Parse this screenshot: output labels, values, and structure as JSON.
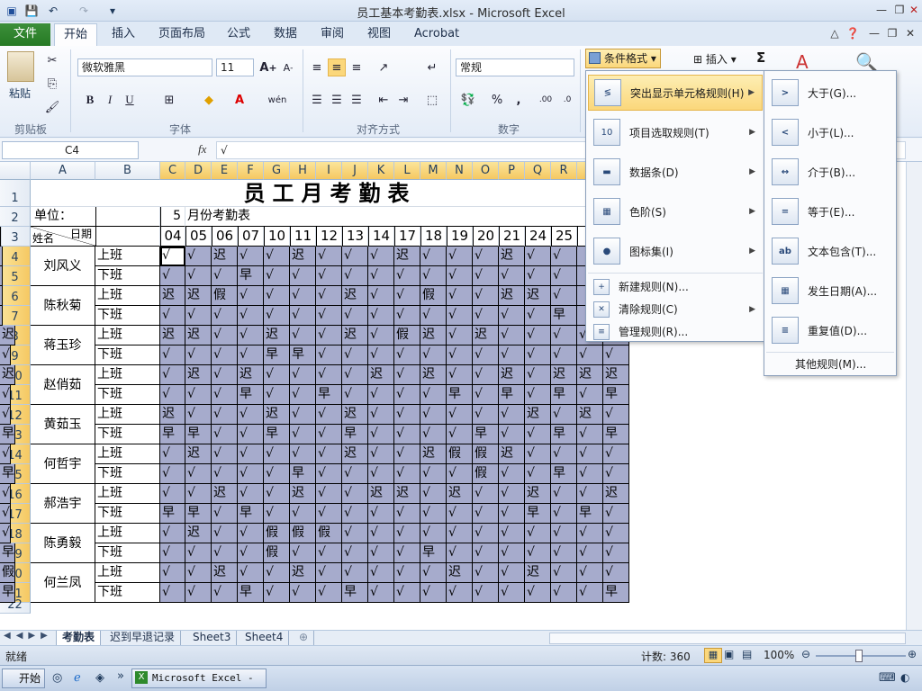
{
  "window": {
    "title": "员工基本考勤表.xlsx - Microsoft Excel"
  },
  "qat": {
    "save": "💾",
    "undo": "↶",
    "redo": "↷",
    "customize": "▾"
  },
  "tabs": [
    {
      "label": "文件"
    },
    {
      "label": "开始"
    },
    {
      "label": "插入"
    },
    {
      "label": "页面布局"
    },
    {
      "label": "公式"
    },
    {
      "label": "数据"
    },
    {
      "label": "审阅"
    },
    {
      "label": "视图"
    },
    {
      "label": "Acrobat"
    }
  ],
  "ribbon": {
    "clipboard": {
      "paste": "粘贴",
      "label": "剪贴板"
    },
    "font": {
      "name": "微软雅黑",
      "size": "11",
      "label": "字体",
      "bold": "B",
      "italic": "I",
      "underline": "U"
    },
    "alignment": {
      "label": "对齐方式"
    },
    "number": {
      "format": "常规",
      "label": "数字",
      "percent": "%",
      "comma": ","
    },
    "styles": {
      "cond_format": "条件格式"
    },
    "cells": {
      "insert": "插入"
    },
    "editing": {
      "sum": "Σ"
    }
  },
  "formula_bar": {
    "name_box": "C4",
    "fx": "fx",
    "value": "√"
  },
  "columns": [
    "A",
    "B",
    "C",
    "D",
    "E",
    "F",
    "G",
    "H",
    "I",
    "J",
    "K",
    "L",
    "M",
    "N",
    "O",
    "P",
    "Q",
    "R",
    "S",
    "T"
  ],
  "sheet": {
    "title": "员工月考勤表",
    "unit_label": "单位：",
    "month": "5",
    "month_label": "月份考勤表",
    "corner_top": "日期",
    "corner_bottom": "姓名",
    "dates": [
      "04",
      "05",
      "06",
      "07",
      "10",
      "11",
      "12",
      "13",
      "14",
      "17",
      "18",
      "19",
      "20",
      "21",
      "24",
      "25",
      "",
      "",
      ""
    ],
    "shift_on": "上班",
    "shift_off": "下班",
    "employees": [
      {
        "name": "刘风义",
        "on": [
          "√",
          "√",
          "迟",
          "√",
          "√",
          "迟",
          "√",
          "√",
          "√",
          "迟",
          "√",
          "√",
          "√",
          "迟",
          "√",
          "√",
          "",
          "",
          ""
        ],
        "off": [
          "√",
          "√",
          "√",
          "早",
          "√",
          "√",
          "√",
          "√",
          "√",
          "√",
          "√",
          "√",
          "√",
          "√",
          "√",
          "√",
          "",
          "",
          ""
        ]
      },
      {
        "name": "陈秋菊",
        "on": [
          "迟",
          "迟",
          "假",
          "√",
          "√",
          "√",
          "√",
          "迟",
          "√",
          "√",
          "假",
          "√",
          "√",
          "迟",
          "迟",
          "√",
          "",
          "",
          ""
        ],
        "off": [
          "√",
          "√",
          "√",
          "√",
          "√",
          "√",
          "√",
          "√",
          "√",
          "√",
          "√",
          "√",
          "√",
          "√",
          "√",
          "早",
          "",
          "",
          ""
        ]
      },
      {
        "name": "蒋玉珍",
        "on": [
          "迟",
          "迟",
          "√",
          "√",
          "迟",
          "√",
          "√",
          "迟",
          "√",
          "假",
          "迟",
          "√",
          "迟",
          "√",
          "√",
          "√",
          "√",
          "迟",
          "迟"
        ],
        "off": [
          "√",
          "√",
          "√",
          "√",
          "早",
          "早",
          "√",
          "√",
          "√",
          "√",
          "√",
          "√",
          "√",
          "√",
          "√",
          "√",
          "√",
          "√",
          "√"
        ]
      },
      {
        "name": "赵俏茹",
        "on": [
          "√",
          "迟",
          "√",
          "迟",
          "√",
          "√",
          "√",
          "√",
          "迟",
          "√",
          "迟",
          "√",
          "√",
          "迟",
          "√",
          "迟",
          "迟",
          "迟",
          "迟"
        ],
        "off": [
          "√",
          "√",
          "√",
          "早",
          "√",
          "√",
          "早",
          "√",
          "√",
          "√",
          "√",
          "早",
          "√",
          "早",
          "√",
          "早",
          "√",
          "早",
          "√"
        ]
      },
      {
        "name": "黄茹玉",
        "on": [
          "迟",
          "√",
          "√",
          "√",
          "迟",
          "√",
          "√",
          "迟",
          "√",
          "√",
          "√",
          "√",
          "√",
          "√",
          "迟",
          "√",
          "迟",
          "√",
          "√"
        ],
        "off": [
          "早",
          "早",
          "√",
          "√",
          "早",
          "√",
          "√",
          "早",
          "√",
          "√",
          "√",
          "√",
          "早",
          "√",
          "√",
          "早",
          "√",
          "早",
          "早"
        ]
      },
      {
        "name": "何哲宇",
        "on": [
          "√",
          "迟",
          "√",
          "√",
          "√",
          "√",
          "√",
          "迟",
          "√",
          "√",
          "迟",
          "假",
          "假",
          "迟",
          "√",
          "√",
          "√",
          "√",
          "√"
        ],
        "off": [
          "√",
          "√",
          "√",
          "√",
          "√",
          "早",
          "√",
          "√",
          "√",
          "√",
          "√",
          "√",
          "假",
          "√",
          "√",
          "早",
          "√",
          "√",
          "早"
        ]
      },
      {
        "name": "郝浩宇",
        "on": [
          "√",
          "√",
          "迟",
          "√",
          "√",
          "迟",
          "√",
          "√",
          "迟",
          "迟",
          "√",
          "迟",
          "√",
          "√",
          "迟",
          "√",
          "√",
          "迟",
          "√"
        ],
        "off": [
          "早",
          "早",
          "√",
          "早",
          "√",
          "√",
          "√",
          "√",
          "√",
          "√",
          "√",
          "√",
          "√",
          "√",
          "早",
          "√",
          "早",
          "√",
          "√"
        ]
      },
      {
        "name": "陈勇毅",
        "on": [
          "√",
          "迟",
          "√",
          "√",
          "假",
          "假",
          "假",
          "√",
          "√",
          "√",
          "√",
          "√",
          "√",
          "√",
          "√",
          "√",
          "√",
          "√",
          "√"
        ],
        "off": [
          "√",
          "√",
          "√",
          "√",
          "假",
          "√",
          "√",
          "√",
          "√",
          "√",
          "早",
          "√",
          "√",
          "√",
          "√",
          "√",
          "√",
          "√",
          "早"
        ]
      },
      {
        "name": "何兰凤",
        "on": [
          "√",
          "√",
          "迟",
          "√",
          "√",
          "迟",
          "√",
          "√",
          "√",
          "√",
          "√",
          "迟",
          "√",
          "√",
          "迟",
          "√",
          "√",
          "√",
          "假"
        ],
        "off": [
          "√",
          "√",
          "√",
          "早",
          "√",
          "√",
          "√",
          "早",
          "√",
          "√",
          "√",
          "√",
          "√",
          "√",
          "√",
          "√",
          "√",
          "早",
          "早"
        ]
      }
    ]
  },
  "cf_menu": {
    "items": [
      {
        "label": "突出显示单元格规则(H)",
        "icon": "highlight-cells-icon",
        "glyph": "≶"
      },
      {
        "label": "项目选取规则(T)",
        "icon": "top-bottom-icon",
        "glyph": "10"
      },
      {
        "label": "数据条(D)",
        "icon": "data-bars-icon",
        "glyph": "▬"
      },
      {
        "label": "色阶(S)",
        "icon": "color-scale-icon",
        "glyph": "▦"
      },
      {
        "label": "图标集(I)",
        "icon": "icon-sets-icon",
        "glyph": "●"
      }
    ],
    "small_items": [
      {
        "label": "新建规则(N)...",
        "icon": "new-rule-icon",
        "glyph": "+"
      },
      {
        "label": "清除规则(C)",
        "icon": "clear-rules-icon",
        "glyph": "✕"
      },
      {
        "label": "管理规则(R)...",
        "icon": "manage-rules-icon",
        "glyph": "≡"
      }
    ]
  },
  "sub_menu": {
    "items": [
      {
        "label": "大于(G)...",
        "glyph": ">"
      },
      {
        "label": "小于(L)...",
        "glyph": "<"
      },
      {
        "label": "介于(B)...",
        "glyph": "↔"
      },
      {
        "label": "等于(E)...",
        "glyph": "="
      },
      {
        "label": "文本包含(T)...",
        "glyph": "ab"
      },
      {
        "label": "发生日期(A)...",
        "glyph": "▦"
      },
      {
        "label": "重复值(D)...",
        "glyph": "≡"
      }
    ],
    "more": "其他规则(M)..."
  },
  "sheet_tabs": [
    "考勤表",
    "迟到早退记录",
    "Sheet3",
    "Sheet4"
  ],
  "status": {
    "ready": "就绪",
    "count": "计数: 360",
    "zoom": "100%"
  },
  "taskbar": {
    "start": "开始",
    "app": "Microsoft Excel - ..."
  },
  "colors": {
    "highlight": "#a6abcc",
    "selected_header": "#f5c862",
    "file_tab": "#2e8a2c"
  }
}
